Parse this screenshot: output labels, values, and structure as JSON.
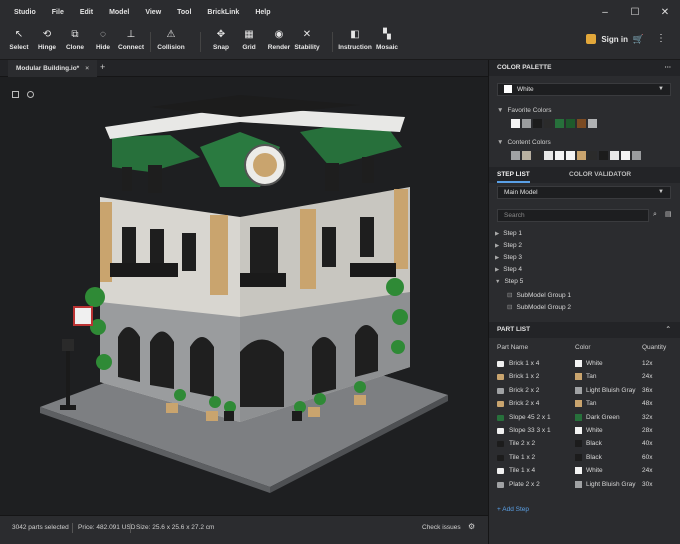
{
  "menu": [
    "Studio",
    "File",
    "Edit",
    "Model",
    "View",
    "Tool",
    "BrickLink",
    "Help"
  ],
  "window_controls": [
    "–",
    "☐",
    "✕"
  ],
  "toolbar": {
    "tools": [
      {
        "id": "select",
        "label": "Select",
        "icon": "cursor-icon",
        "glyph": "↖"
      },
      {
        "id": "hinge",
        "label": "Hinge",
        "icon": "hinge-icon",
        "glyph": "⟲"
      },
      {
        "id": "clone",
        "label": "Clone",
        "icon": "clone-icon",
        "glyph": "⧉"
      },
      {
        "id": "hide",
        "label": "Hide",
        "icon": "hide-icon",
        "glyph": "◌"
      },
      {
        "id": "connect",
        "label": "Connect",
        "icon": "connect-icon",
        "glyph": "⊥"
      },
      {
        "id": "collision",
        "label": "Collision",
        "icon": "collision-icon",
        "glyph": "⚠"
      },
      {
        "id": "snap",
        "label": "Snap",
        "icon": "snap-icon",
        "glyph": "✥"
      },
      {
        "id": "grid",
        "label": "Grid",
        "icon": "grid-icon",
        "glyph": "▦"
      },
      {
        "id": "render",
        "label": "Render",
        "icon": "camera-icon",
        "glyph": "◉"
      },
      {
        "id": "stability",
        "label": "Stability",
        "icon": "stability-icon",
        "glyph": "✕"
      },
      {
        "id": "instruction",
        "label": "Instruction",
        "icon": "instruction-icon",
        "glyph": "◧"
      },
      {
        "id": "mosaic",
        "label": "Mosaic",
        "icon": "mosaic-icon",
        "glyph": "▚"
      }
    ],
    "signin_label": "Sign in"
  },
  "tab": {
    "title": "Modular Building.io*",
    "close": "×",
    "add": "+"
  },
  "status": {
    "parts_selected": "3042 parts selected",
    "price": "Price: 482.091 USD",
    "size": "Size: 25.6 x 25.6 x 27.2 cm",
    "check": "Check issues"
  },
  "color_palette": {
    "header": "COLOR PALETTE",
    "selected": "White",
    "favorite_label": "Favorite Colors",
    "favorite_colors": [
      "#f4f4f4",
      "#9a9c9e",
      "#1c1c1c",
      "#2b2b2b",
      "#27703b",
      "#1e5a2c",
      "#7a4a22",
      "#b0b2b4"
    ],
    "content_label": "Content Colors",
    "content_colors": [
      "#a0a2a4",
      "#b8b0a0",
      "#2a2a2a",
      "#e8e8e8",
      "#f4f4f4",
      "#f4f4f4",
      "#c9a46e",
      "#2b2b2b",
      "#1c1c1c",
      "#e8e8e8",
      "#f4f4f4",
      "#9a9c9e"
    ]
  },
  "step_tabs": [
    "STEP LIST",
    "COLOR VALIDATOR"
  ],
  "step_list": {
    "model": "Main Model",
    "search_placeholder": "Search",
    "steps": [
      "Step 1",
      "Step 2",
      "Step 3",
      "Step 4",
      "Step 5"
    ],
    "submodels": [
      "SubModel Group 1",
      "SubModel Group 2"
    ]
  },
  "part_list": {
    "header": "PART LIST",
    "columns": [
      "Part Name",
      "Color",
      "Quantity"
    ],
    "rows": [
      {
        "name": "Brick 1 x 4",
        "color": "White",
        "swatch": "#f4f4f4",
        "qty": "12x",
        "icon": "#f0f0f0"
      },
      {
        "name": "Brick 1 x 2",
        "color": "Tan",
        "swatch": "#c9a46e",
        "qty": "24x",
        "icon": "#c9a46e"
      },
      {
        "name": "Brick 2 x 2",
        "color": "Light Bluish Gray",
        "swatch": "#a0a2a4",
        "qty": "36x",
        "icon": "#a0a2a4"
      },
      {
        "name": "Brick 2 x 4",
        "color": "Tan",
        "swatch": "#c9a46e",
        "qty": "48x",
        "icon": "#c9a46e"
      },
      {
        "name": "Slope 45 2 x 1",
        "color": "Dark Green",
        "swatch": "#27703b",
        "qty": "32x",
        "icon": "#27703b"
      },
      {
        "name": "Slope 33 3 x 1",
        "color": "White",
        "swatch": "#f4f4f4",
        "qty": "28x",
        "icon": "#f0f0f0"
      },
      {
        "name": "Tile 2 x 2",
        "color": "Black",
        "swatch": "#1c1c1c",
        "qty": "40x",
        "icon": "#1c1c1c"
      },
      {
        "name": "Tile 1 x 2",
        "color": "Black",
        "swatch": "#1c1c1c",
        "qty": "60x",
        "icon": "#1c1c1c"
      },
      {
        "name": "Tile 1 x 4",
        "color": "White",
        "swatch": "#f4f4f4",
        "qty": "24x",
        "icon": "#f0f0f0"
      },
      {
        "name": "Plate 2 x 2",
        "color": "Light Bluish Gray",
        "swatch": "#a0a2a4",
        "qty": "30x",
        "icon": "#a0a2a4"
      }
    ],
    "add_step": "+ Add Step"
  },
  "accent": "#5aa0e6"
}
